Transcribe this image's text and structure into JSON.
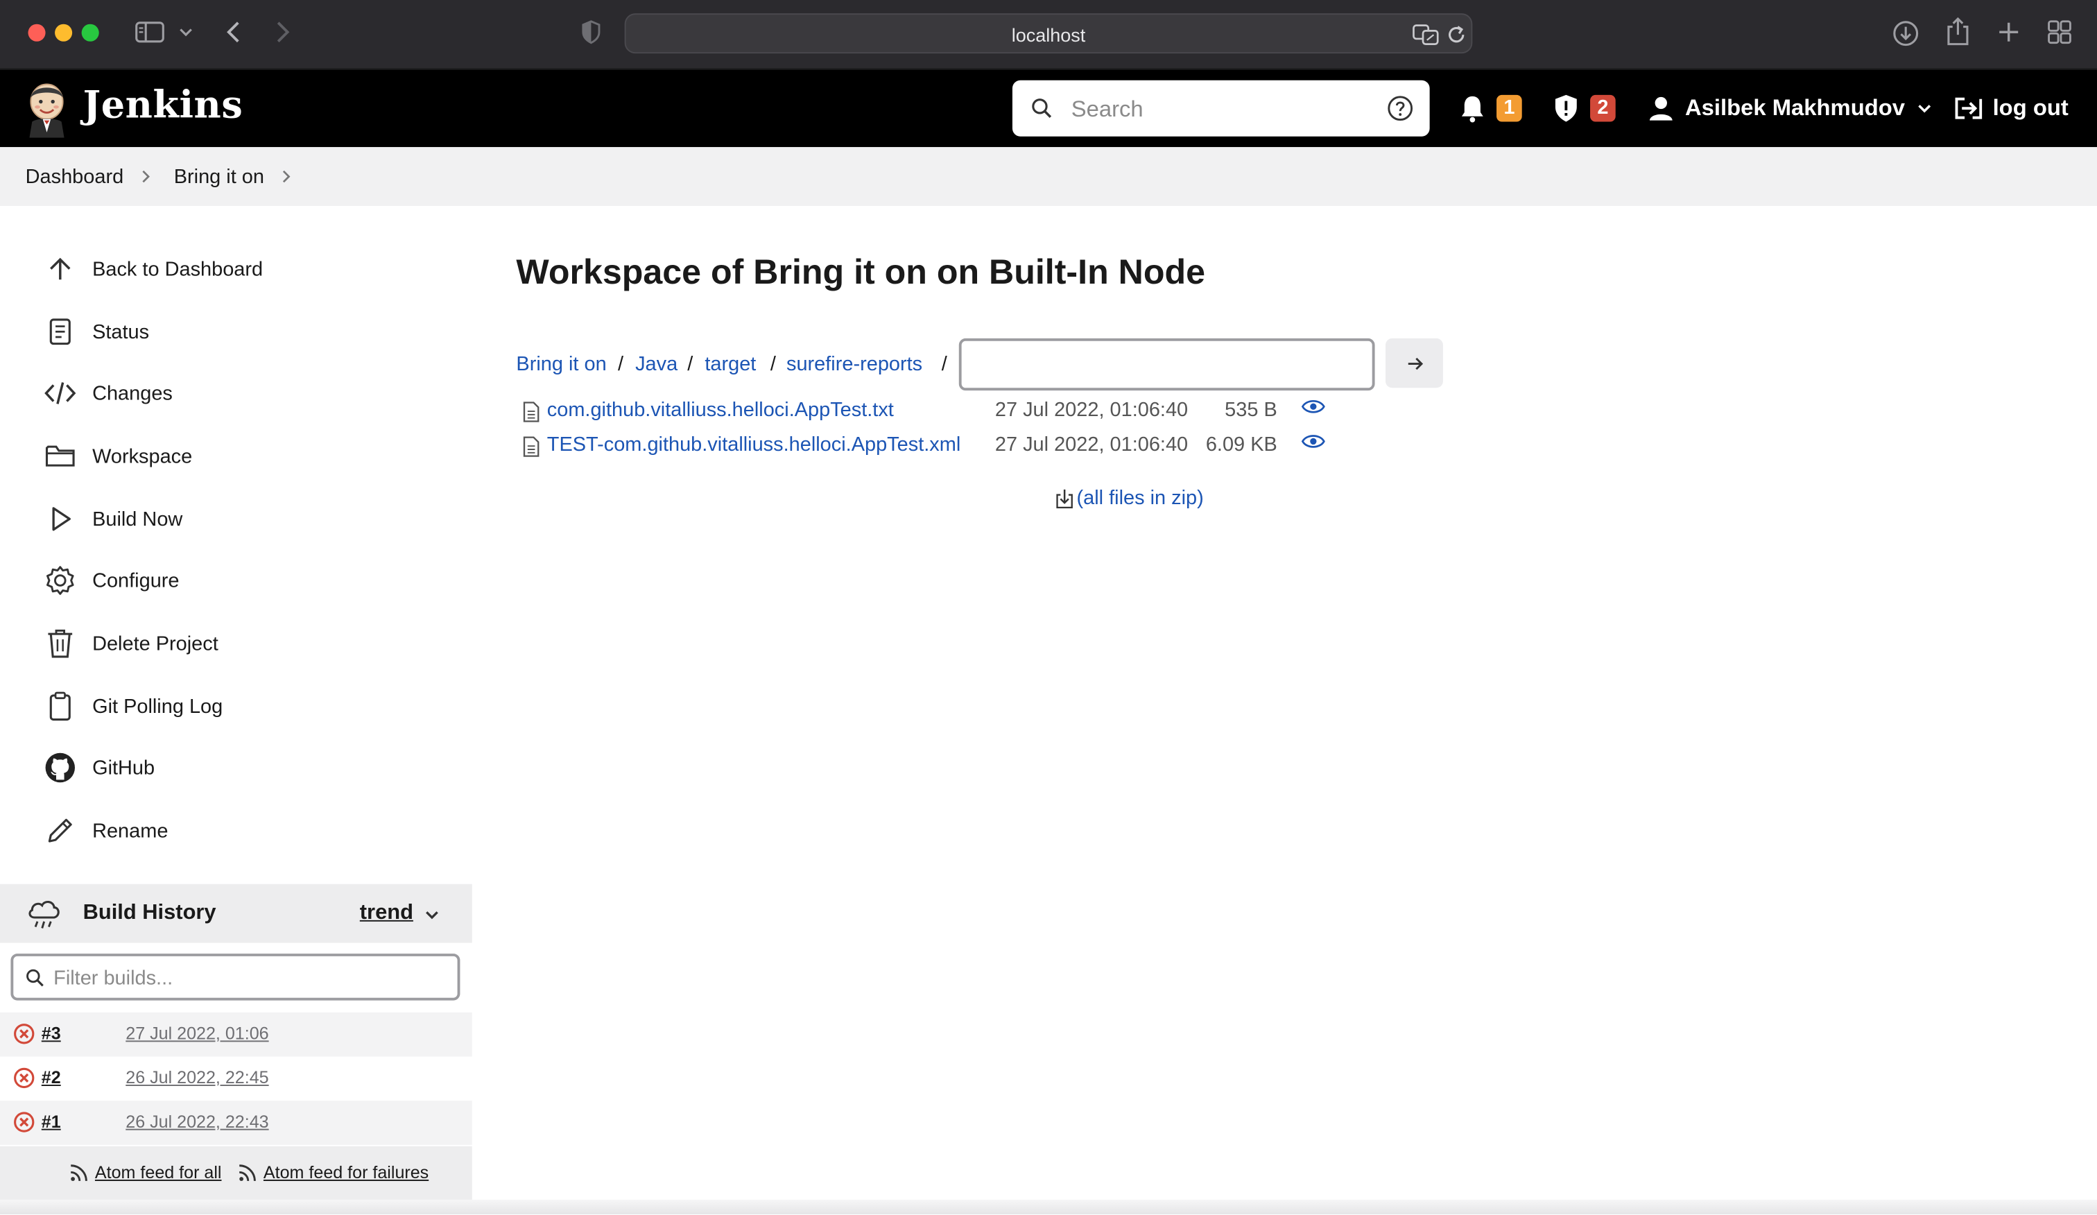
{
  "browser": {
    "url_host": "localhost"
  },
  "header": {
    "brand": "Jenkins",
    "search_placeholder": "Search",
    "notifications_count": "1",
    "security_count": "2",
    "user_name": "Asilbek Makhmudov",
    "logout_label": "log out",
    "colors": {
      "bar": "#000000",
      "notify_badge": "#f39c32",
      "security_badge": "#d24939"
    }
  },
  "breadcrumb": {
    "items": [
      "Dashboard",
      "Bring it on"
    ]
  },
  "sidebar": {
    "items": [
      {
        "label": "Back to Dashboard",
        "icon": "arrow-up-icon"
      },
      {
        "label": "Status",
        "icon": "document-icon"
      },
      {
        "label": "Changes",
        "icon": "code-icon"
      },
      {
        "label": "Workspace",
        "icon": "folder-icon"
      },
      {
        "label": "Build Now",
        "icon": "play-icon"
      },
      {
        "label": "Configure",
        "icon": "gear-icon"
      },
      {
        "label": "Delete Project",
        "icon": "trash-icon"
      },
      {
        "label": "Git Polling Log",
        "icon": "clipboard-icon"
      },
      {
        "label": "GitHub",
        "icon": "github-icon"
      },
      {
        "label": "Rename",
        "icon": "pencil-icon"
      }
    ]
  },
  "build_history": {
    "title": "Build History",
    "trend_label": "trend",
    "filter_placeholder": "Filter builds...",
    "builds": [
      {
        "number": "#3",
        "date": "27 Jul 2022, 01:06",
        "status": "failed"
      },
      {
        "number": "#2",
        "date": "26 Jul 2022, 22:45",
        "status": "failed"
      },
      {
        "number": "#1",
        "date": "26 Jul 2022, 22:43",
        "status": "failed"
      }
    ],
    "feed_all": "Atom feed for all",
    "feed_failures": "Atom feed for failures"
  },
  "main": {
    "title": "Workspace of Bring it on on Built-In Node",
    "path": [
      "Bring it on",
      "Java",
      "target",
      "surefire-reports"
    ],
    "path_separator": "/",
    "path_input_value": "",
    "files": [
      {
        "name": "com.github.vitalliuss.helloci.AppTest.txt",
        "date": "27 Jul 2022, 01:06:40",
        "size": "535 B"
      },
      {
        "name": "TEST-com.github.vitalliuss.helloci.AppTest.xml",
        "date": "27 Jul 2022, 01:06:40",
        "size": "6.09 KB"
      }
    ],
    "zip_link": "(all files in zip)",
    "link_color": "#1c55b4"
  }
}
